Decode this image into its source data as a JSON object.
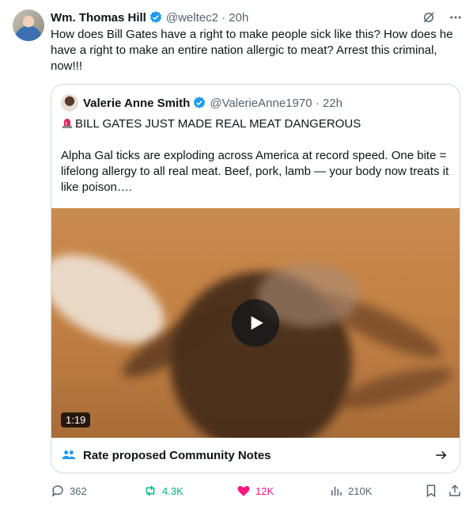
{
  "tweet": {
    "author_name": "Wm. Thomas Hill",
    "handle": "@weltec2",
    "time": "20h",
    "text": "How does Bill Gates have a right to make people sick like this? How does he have a right to make an entire nation allergic to meat? Arrest this criminal, now!!!"
  },
  "quote": {
    "author_name": "Valerie Anne Smith",
    "handle": "@ValerieAnne1970",
    "time": "22h",
    "headline": "BILL GATES JUST MADE REAL MEAT DANGEROUS",
    "body": "Alpha Gal ticks are exploding across America at record speed. One bite = lifelong allergy to all real meat. Beef, pork, lamb — your body now treats it like poison….",
    "video_duration": "1:19"
  },
  "community_notes": {
    "label": "Rate proposed Community Notes"
  },
  "actions": {
    "replies": "362",
    "reposts": "4.3K",
    "likes": "12K",
    "views": "210K"
  },
  "colors": {
    "verified": "#1d9bf0",
    "repost": "#00ba7c",
    "like": "#f91880",
    "notes_icon": "#1d9bf0"
  }
}
